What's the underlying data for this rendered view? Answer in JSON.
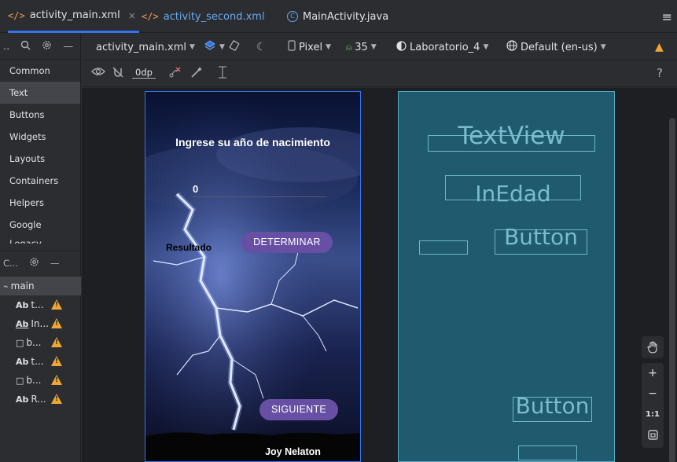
{
  "tabs": [
    {
      "label": "activity_main.xml",
      "icon": "xml-icon",
      "active": true,
      "close": "×"
    },
    {
      "label": "activity_second.xml",
      "icon": "xml-icon",
      "active": false
    },
    {
      "label": "MainActivity.java",
      "icon": "class-icon",
      "active": false
    }
  ],
  "palette": {
    "items": [
      "Common",
      "Text",
      "Buttons",
      "Widgets",
      "Layouts",
      "Containers",
      "Helpers",
      "Google",
      "Legacy"
    ],
    "selected": "Text",
    "tree_header": "C...",
    "head_dots": ".."
  },
  "tree": {
    "root": "main",
    "items": [
      {
        "icon": "Ab",
        "label": "t..."
      },
      {
        "icon": "Ab",
        "label": "In..."
      },
      {
        "icon": "□",
        "label": "b..."
      },
      {
        "icon": "Ab",
        "label": "t..."
      },
      {
        "icon": "□",
        "label": "b..."
      },
      {
        "icon": "Ab",
        "label": "R..."
      }
    ]
  },
  "toolbar": {
    "file": "activity_main.xml",
    "device": "Pixel",
    "api": "35",
    "theme": "Laboratorio_4",
    "locale": "Default (en-us)",
    "margin": "0dp",
    "help": "?"
  },
  "design": {
    "title": "Ingrese su año de nacimiento",
    "input_value": "0",
    "result": "Resultado",
    "determinar": "DETERMINAR",
    "siguiente": "SIGUIENTE",
    "footer": "Joy Nelaton"
  },
  "blueprint": {
    "textview": "TextView",
    "inedad": "InEdad",
    "button1": "Button",
    "button2": "Button"
  },
  "zoom": {
    "plus": "+",
    "minus": "−",
    "ratio": "1:1"
  },
  "colors": {
    "accent": "#3574f0",
    "button": "#6750a4",
    "blueprint": "#1f5a6e",
    "warning": "#f0a732"
  }
}
